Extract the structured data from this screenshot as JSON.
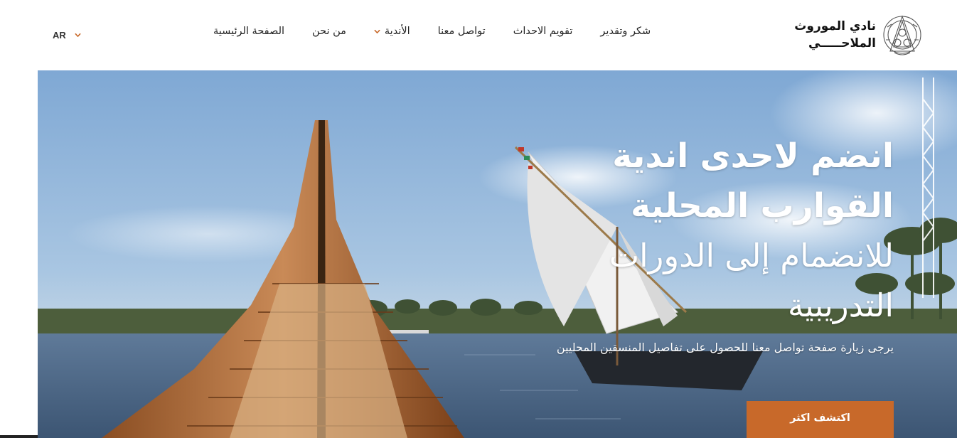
{
  "header": {
    "language": {
      "label": "AR",
      "icon": "chevron-down-icon"
    },
    "nav": [
      {
        "label": "الصفحة الرئيسية",
        "has_dropdown": false
      },
      {
        "label": "من نحن",
        "has_dropdown": false
      },
      {
        "label": "الأندية",
        "has_dropdown": true
      },
      {
        "label": "تواصل معنا",
        "has_dropdown": false
      },
      {
        "label": "تقويم الاحداث",
        "has_dropdown": false
      },
      {
        "label": "شكر وتقدير",
        "has_dropdown": false
      }
    ],
    "logo": {
      "line1": "نادي الموروث",
      "line2": "الملاحـــــي"
    }
  },
  "hero": {
    "title_bold": "انضم لاحدى اندية القوارب المحلية",
    "title_light": "للانضمام إلى الدورات التدريبية",
    "subtitle": "يرجى زيارة صفحة تواصل معنا للحصول على تفاصيل المنسقين المحليين",
    "cta_label": "اكتشف اكثر"
  },
  "colors": {
    "accent": "#c8692a",
    "nav_text": "#222222",
    "hero_text": "#ffffff"
  }
}
